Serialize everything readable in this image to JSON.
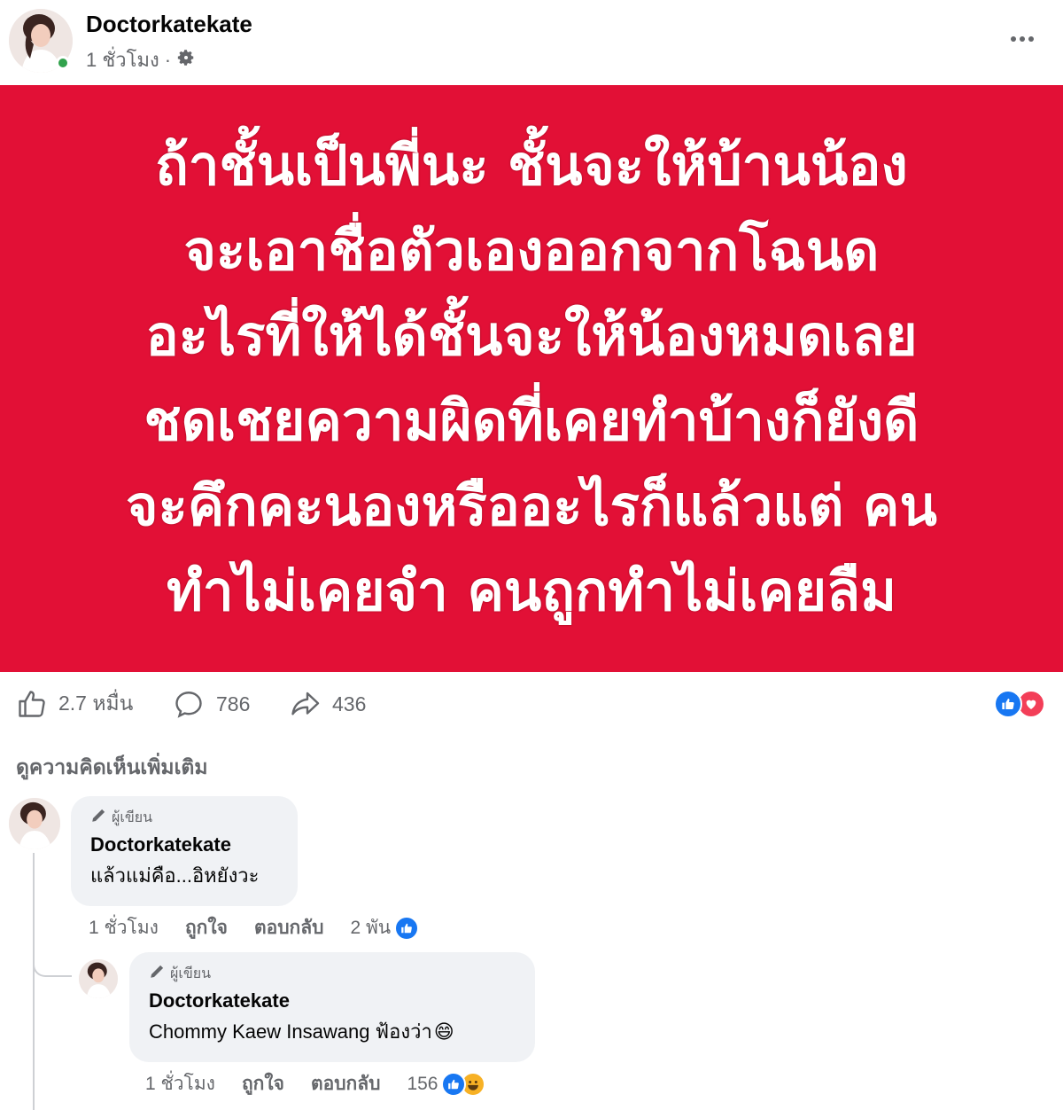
{
  "post": {
    "author": "Doctorkatekate",
    "time": "1 ชั่วโมง",
    "separator": "·",
    "privacy_icon": "settings-icon",
    "more_icon": "more-options-icon"
  },
  "banner": {
    "background": "#e21036",
    "lines": [
      "ถ้าชั้นเป็นพี่นะ ชั้นจะให้บ้านน้อง",
      "จะเอาชื่อตัวเองออกจากโฉนด",
      "อะไรที่ให้ได้ชั้นจะให้น้องหมดเลย",
      "ชดเชยความผิดที่เคยทำบ้างก็ยังดี",
      "จะคึกคะนองหรืออะไรก็แล้วแต่ คน",
      "ทำไม่เคยจำ คนถูกทำไม่เคยลืม"
    ]
  },
  "stats": {
    "likes": "2.7 หมื่น",
    "comments": "786",
    "shares": "436",
    "reaction_icons": [
      "like-icon",
      "love-icon"
    ]
  },
  "more_comments_label": "ดูความคิดเห็นเพิ่มเติม",
  "comments": [
    {
      "author_tag": "ผู้เขียน",
      "name": "Doctorkatekate",
      "text": "แล้วแม่คือ...อิหยังวะ",
      "time": "1 ชั่วโมง",
      "like_label": "ถูกใจ",
      "reply_label": "ตอบกลับ",
      "reaction_count": "2 พัน"
    },
    {
      "author_tag": "ผู้เขียน",
      "name": "Doctorkatekate",
      "text": "Chommy Kaew Insawang ฟ้องว่า",
      "emoji": "😄",
      "time": "1 ชั่วโมง",
      "like_label": "ถูกใจ",
      "reply_label": "ตอบกลับ",
      "reaction_count": "156"
    }
  ],
  "colors": {
    "like_blue": "#1877f2",
    "love_red": "#f33e58",
    "haha_yellow": "#f7b125",
    "online_green": "#31a24c",
    "muted_text": "#65676b"
  }
}
